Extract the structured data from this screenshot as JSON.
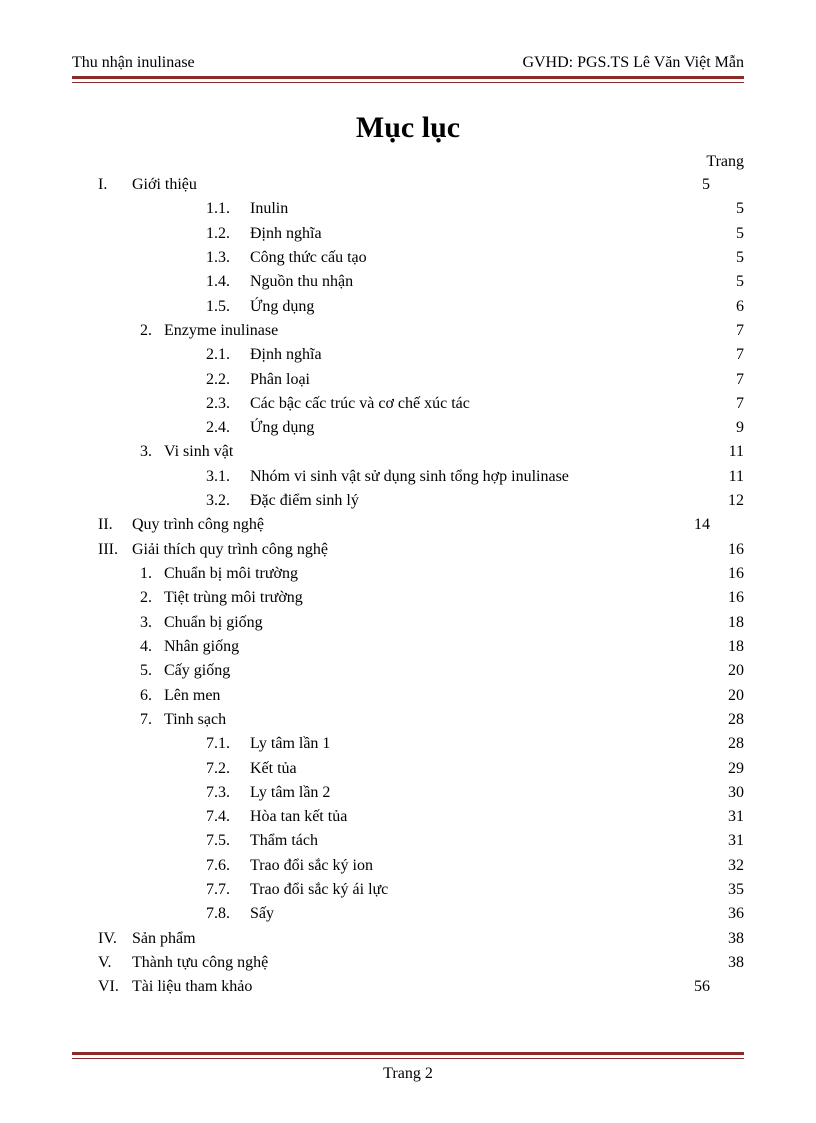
{
  "header": {
    "left": "Thu nhận inulinase",
    "right": "GVHD: PGS.TS Lê Văn Việt Mẫn"
  },
  "title": "Mục lục",
  "trang_label": "Trang",
  "footer_page": "Trang 2",
  "toc": [
    {
      "level": "roman",
      "num": "I.",
      "text": "Giới thiệu",
      "page": "5",
      "page_col": "roman"
    },
    {
      "level": "sub",
      "num": "1.1.",
      "text": "Inulin",
      "page": "5"
    },
    {
      "level": "sub",
      "num": "1.2.",
      "text": "Định nghĩa",
      "page": "5"
    },
    {
      "level": "sub",
      "num": "1.3.",
      "text": "Công  thức cấu tạo",
      "page": "5"
    },
    {
      "level": "sub",
      "num": "1.4.",
      "text": "Nguồn thu nhận",
      "page": "5"
    },
    {
      "level": "sub",
      "num": "1.5.",
      "text": "Ứng dụng",
      "page": "6"
    },
    {
      "level": "arab",
      "num": "2.",
      "text": "Enzyme inulinase",
      "page": "7"
    },
    {
      "level": "sub",
      "num": "2.1.",
      "text": "Định nghĩa",
      "page": "7"
    },
    {
      "level": "sub",
      "num": "2.2.",
      "text": "Phân loại",
      "page": "7"
    },
    {
      "level": "sub",
      "num": "2.3.",
      "text": "Các bậc cấc trúc và cơ chế xúc tác",
      "page": "7"
    },
    {
      "level": "sub",
      "num": "2.4.",
      "text": "Ứng dụng",
      "page": "9"
    },
    {
      "level": "arab",
      "num": "3.",
      "text": "Vi sinh vật",
      "page": "11"
    },
    {
      "level": "sub",
      "num": "3.1.",
      "text": "Nhóm vi sinh vật sử dụng sinh tổng hợp inulinase",
      "page": "11"
    },
    {
      "level": "sub",
      "num": "3.2.",
      "text": "Đặc điểm sinh lý",
      "page": "12"
    },
    {
      "level": "roman",
      "num": "II.",
      "text": "Quy trình công nghệ",
      "page": "14",
      "page_col": "roman"
    },
    {
      "level": "roman",
      "num": "III.",
      "text": "Giải thích quy trình công nghệ",
      "page": "16"
    },
    {
      "level": "arab",
      "num": "1.",
      "text": "Chuẩn bị môi trường",
      "page": "16"
    },
    {
      "level": "arab",
      "num": "2.",
      "text": "Tiệt trùng môi trường",
      "page": "16"
    },
    {
      "level": "arab",
      "num": "3.",
      "text": "Chuẩn bị giống",
      "page": "18"
    },
    {
      "level": "arab",
      "num": "4.",
      "text": "Nhân giống",
      "page": "18"
    },
    {
      "level": "arab",
      "num": "5.",
      "text": "Cấy giống",
      "page": "20"
    },
    {
      "level": "arab",
      "num": "6.",
      "text": "Lên men",
      "page": "20"
    },
    {
      "level": "arab",
      "num": "7.",
      "text": "Tinh sạch",
      "page": "28"
    },
    {
      "level": "sub",
      "num": "7.1.",
      "text": "Ly tâm lần 1",
      "page": "28"
    },
    {
      "level": "sub",
      "num": "7.2.",
      "text": "Kết tủa",
      "page": "29"
    },
    {
      "level": "sub",
      "num": "7.3.",
      "text": "Ly tâm lần 2",
      "page": "30"
    },
    {
      "level": "sub",
      "num": "7.4.",
      "text": "Hòa tan kết tủa",
      "page": "31"
    },
    {
      "level": "sub",
      "num": "7.5.",
      "text": "Thẩm tách",
      "page": "31"
    },
    {
      "level": "sub",
      "num": "7.6.",
      "text": "Trao đổi sắc ký ion",
      "page": "32"
    },
    {
      "level": "sub",
      "num": "7.7.",
      "text": "Trao đổi sắc ký ái lực",
      "page": "35"
    },
    {
      "level": "sub",
      "num": "7.8.",
      "text": "Sấy",
      "page": "36"
    },
    {
      "level": "roman",
      "num": "IV.",
      "text": "Sản phẩm",
      "page": "38"
    },
    {
      "level": "roman",
      "num": "V.",
      "text": "Thành tựu công nghệ",
      "page": "38"
    },
    {
      "level": "roman",
      "num": "VI.",
      "text": "Tài liệu tham khảo",
      "page": "56",
      "page_col": "roman"
    }
  ]
}
